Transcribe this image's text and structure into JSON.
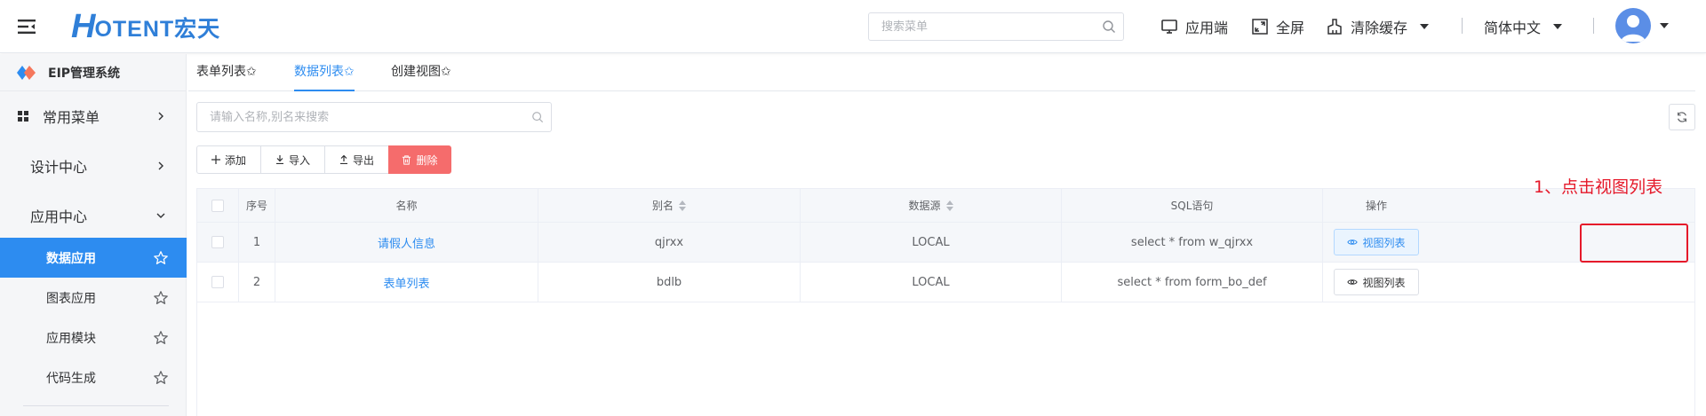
{
  "header": {
    "logo_h": "H",
    "logo_rest": "OTENT宏天",
    "search_placeholder": "搜索菜单",
    "app_client": "应用端",
    "fullscreen": "全屏",
    "clear_cache": "清除缓存",
    "language": "简体中文"
  },
  "sidebar": {
    "system_title": "EIP管理系统",
    "common_menu": "常用菜单",
    "design_center": "设计中心",
    "app_center": "应用中心",
    "sub_items": [
      "数据应用",
      "图表应用",
      "应用模块",
      "代码生成"
    ],
    "active_index": 0
  },
  "tabs": [
    {
      "label": "表单列表✩"
    },
    {
      "label": "数据列表✩"
    },
    {
      "label": "创建视图✩"
    }
  ],
  "active_tab": 1,
  "filter_placeholder": "请输入名称,别名来搜索",
  "toolbar": {
    "add": "添加",
    "import": "导入",
    "export": "导出",
    "delete": "删除"
  },
  "table": {
    "headers": {
      "index": "序号",
      "name": "名称",
      "alias": "别名",
      "datasource": "数据源",
      "sql": "SQL语句",
      "actions": "操作"
    },
    "rows": [
      {
        "index": "1",
        "name": "请假人信息",
        "alias": "qjrxx",
        "datasource": "LOCAL",
        "sql": "select * from w_qjrxx",
        "action": "视图列表"
      },
      {
        "index": "2",
        "name": "表单列表",
        "alias": "bdlb",
        "datasource": "LOCAL",
        "sql": "select * from form_bo_def",
        "action": "视图列表"
      }
    ]
  },
  "annotation": "1、点击视图列表",
  "colors": {
    "primary": "#2d8cf0",
    "danger": "#f56c6c",
    "annotation_red": "#e5192a"
  }
}
